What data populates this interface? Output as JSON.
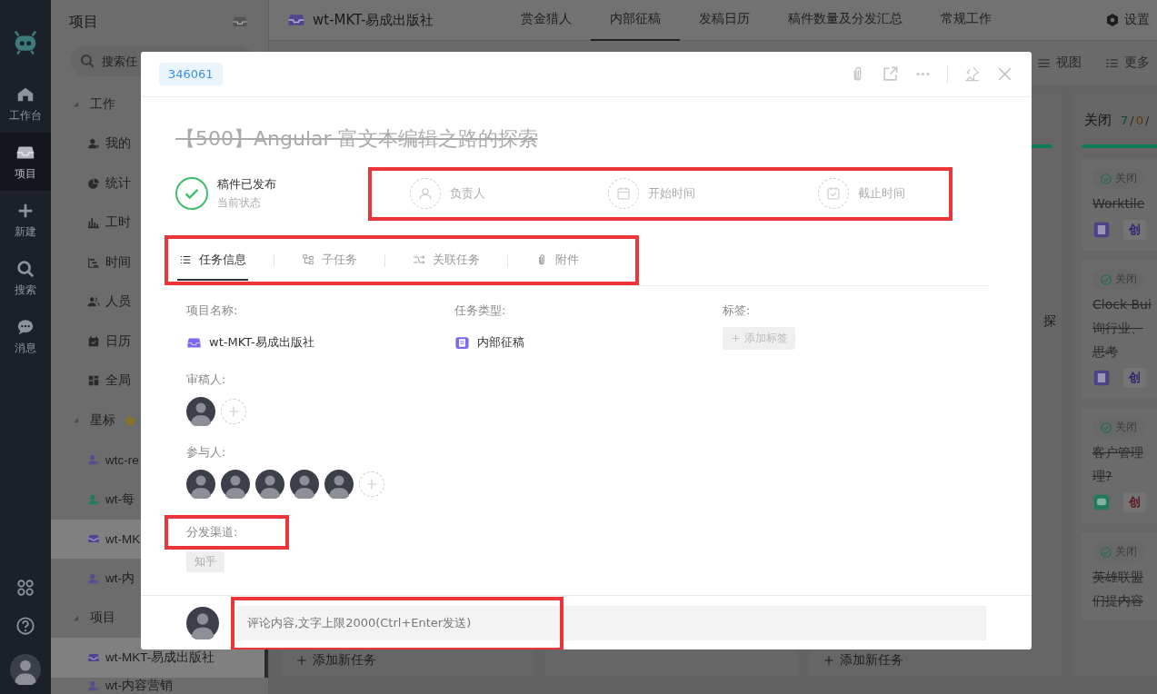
{
  "rail": {
    "items": [
      {
        "label": "工作台",
        "kind": "home",
        "selected": false
      },
      {
        "label": "项目",
        "kind": "box",
        "selected": true
      },
      {
        "label": "新建",
        "kind": "plus",
        "selected": false
      },
      {
        "label": "搜索",
        "kind": "search",
        "selected": false
      },
      {
        "label": "消息",
        "kind": "chat",
        "selected": false
      }
    ],
    "bottom": [
      {
        "kind": "apps"
      },
      {
        "kind": "help"
      },
      {
        "kind": "avatar"
      }
    ]
  },
  "sidebar": {
    "title": "项目",
    "search": {
      "placeholder": "搜索任"
    },
    "groups": [
      {
        "label": "工作",
        "star": false,
        "expanded": true,
        "items": [
          {
            "label": "我的",
            "kind": "user",
            "selected": false
          },
          {
            "label": "统计",
            "kind": "pie",
            "selected": false
          },
          {
            "label": "工时",
            "kind": "bars",
            "selected": false
          },
          {
            "label": "时间",
            "kind": "gantt",
            "selected": false
          },
          {
            "label": "人员",
            "kind": "users",
            "selected": false
          },
          {
            "label": "日历",
            "kind": "calendar",
            "selected": false
          },
          {
            "label": "全局",
            "kind": "grid",
            "selected": false
          }
        ]
      },
      {
        "label": "星标",
        "star": true,
        "expanded": true,
        "items": [
          {
            "label": "wtc-re",
            "kind": "user",
            "color": "#5a4a8e",
            "selected": false
          },
          {
            "label": "wt-每",
            "kind": "user",
            "color": "#1f7a62",
            "selected": false
          },
          {
            "label": "wt-MK",
            "kind": "box",
            "color": "#4f4590",
            "selected": true
          },
          {
            "label": "wt-内",
            "kind": "user",
            "color": "#5a4a8e",
            "selected": false
          }
        ]
      },
      {
        "label": "项目",
        "star": false,
        "expanded": true,
        "items": [
          {
            "label": "wt-MKT-易成出版社",
            "kind": "box",
            "color": "#4f4590",
            "selected": true
          },
          {
            "label": "wt-内容营销",
            "kind": "user",
            "color": "#5a4a8e",
            "selected": false
          }
        ]
      }
    ]
  },
  "topbar": {
    "project": "wt-MKT-易成出版社",
    "tabs": [
      {
        "label": "赏金猎人",
        "selected": false
      },
      {
        "label": "内部征稿",
        "selected": true
      },
      {
        "label": "发稿日历",
        "selected": false
      },
      {
        "label": "稿件数量及分发汇总",
        "selected": false
      },
      {
        "label": "常规工作",
        "selected": false
      }
    ],
    "settings": "设置"
  },
  "toolbar": [
    {
      "label": "视图",
      "kind": "view"
    },
    {
      "label": "更多",
      "kind": "more"
    }
  ],
  "board": {
    "columns": [
      {
        "add": "添加新任务"
      },
      {},
      {
        "snippet": "探",
        "add": "添加新任务"
      },
      {
        "title": "关闭",
        "counts": [
          {
            "text": "7",
            "color": "#0f4a30"
          },
          {
            "text": "/",
            "color": "#2a2a2a"
          },
          {
            "text": "0",
            "color": "#553a00"
          },
          {
            "text": "/",
            "color": "#2a2a2a"
          }
        ],
        "cards": [
          {
            "badge": "关闭",
            "lines": [
              "Worktile"
            ],
            "type": {
              "kind": "doc",
              "color": "#4a4385"
            },
            "tag": {
              "text": "创",
              "color": "#2e2570"
            }
          },
          {
            "badge": "关闭",
            "lines": [
              "Clock Bui",
              "询行业、",
              "思考"
            ],
            "type": {
              "kind": "doc",
              "color": "#4a4385"
            },
            "tag": {
              "text": "创",
              "color": "#2e2570"
            }
          },
          {
            "badge": "关闭",
            "lines": [
              "客户管理",
              "理?"
            ],
            "type": {
              "kind": "chat",
              "color": "#1f7a5e"
            },
            "tag": {
              "text": "创",
              "color": "#5e1520"
            }
          },
          {
            "badge": "关闭",
            "lines": [
              "英雄联盟",
              "们提内容"
            ]
          }
        ]
      }
    ]
  },
  "task": {
    "id": "346061",
    "actions": [
      {
        "kind": "attach"
      },
      {
        "kind": "open"
      },
      {
        "kind": "more"
      },
      {
        "kind": "pin"
      },
      {
        "kind": "close"
      }
    ],
    "title": "【500】Angular 富文本编辑之路的探索",
    "done": true,
    "status": {
      "label": "稿件已发布",
      "caption": "当前状态"
    },
    "quick_fields": {
      "highlighted": true,
      "items": [
        {
          "label": "负责人",
          "kind": "user"
        },
        {
          "label": "开始时间",
          "kind": "calendar"
        },
        {
          "label": "截止时间",
          "kind": "deadline"
        }
      ]
    },
    "tabs": {
      "highlighted": true,
      "items": [
        {
          "label": "任务信息",
          "kind": "list",
          "selected": true
        },
        {
          "label": "子任务",
          "kind": "tree",
          "selected": false
        },
        {
          "label": "关联任务",
          "kind": "link",
          "selected": false
        },
        {
          "label": "附件",
          "kind": "attach",
          "selected": false
        }
      ]
    },
    "fields": [
      {
        "label": "项目名称:",
        "kind": "project",
        "value": "wt-MKT-易成出版社"
      },
      {
        "label": "任务类型:",
        "kind": "type",
        "value": "内部征稿"
      },
      {
        "label": "标签:",
        "kind": "tags",
        "add": "添加标签"
      }
    ],
    "reviewers": {
      "label": "审稿人:",
      "people": [
        {
          "kind": "photo"
        }
      ]
    },
    "participants": {
      "label": "参与人:",
      "people": [
        {
          "kind": "photo"
        },
        {
          "kind": "photo"
        },
        {
          "kind": "photo"
        },
        {
          "kind": "photo"
        },
        {
          "kind": "photo"
        }
      ]
    },
    "channels": {
      "label": "分发渠道:",
      "highlighted": true,
      "tags": [
        "知乎"
      ]
    },
    "comment": {
      "placeholder": "评论内容,文字上限2000(Ctrl+Enter发送)",
      "highlighted": true
    }
  }
}
